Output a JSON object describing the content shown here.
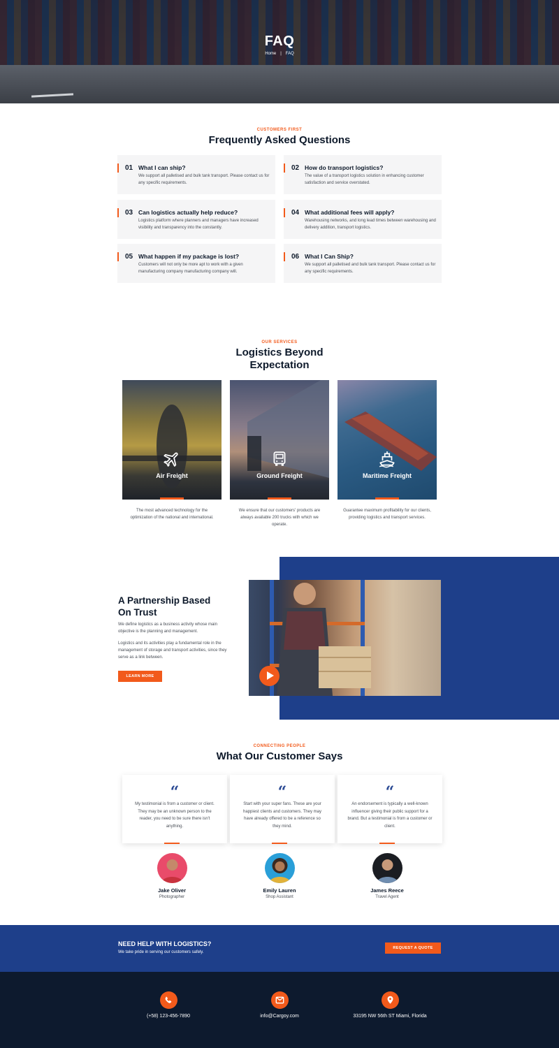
{
  "hero": {
    "title": "FAQ",
    "breadcrumb": {
      "home": "Home",
      "separator": "|",
      "current": "FAQ"
    }
  },
  "faq": {
    "eyebrow": "CUSTOMERS FIRST",
    "title": "Frequently Asked Questions",
    "items": [
      {
        "num": "01",
        "question": "What I can ship?",
        "answer": "We support all palletised and bulk tank transport. Please contact us for any specific requirements."
      },
      {
        "num": "02",
        "question": "How do transport logistics?",
        "answer": "The value of a transport logistics solution in enhancing customer satisfaction and service overstated."
      },
      {
        "num": "03",
        "question": "Can logistics actually help reduce?",
        "answer": "Logistics platform where planners and managers have increased visibility and transparency into the constantly."
      },
      {
        "num": "04",
        "question": "What additional fees will apply?",
        "answer": "Warehousing networks, and long lead times between warehousing and delivery addition, transport logistics."
      },
      {
        "num": "05",
        "question": "What happen if my package is lost?",
        "answer": "Customers will not only be more apt to work with a given manufacturing company manufacturing company will."
      },
      {
        "num": "06",
        "question": "What I Can Ship?",
        "answer": "We support all palletised and bulk tank transport. Please contact us for any specific requirements."
      }
    ]
  },
  "services": {
    "eyebrow": "OUR SERVICES",
    "title_line1": "Logistics Beyond",
    "title_line2": "Expectation",
    "items": [
      {
        "label": "Air Freight",
        "icon": "airplane-icon",
        "description": "The most advanced technology for the optimization of the national and international."
      },
      {
        "label": "Ground Freight",
        "icon": "truck-icon",
        "description": "We ensure that our customers' products are always available 200 trucks with which we operate."
      },
      {
        "label": "Maritime Freight",
        "icon": "ship-icon",
        "description": "Guarantee maximum profitability for our clients, providing logistics and transport services."
      }
    ]
  },
  "partnership": {
    "title_line1": "A Partnership Based",
    "title_line2": "On Trust",
    "paragraph1": "We define logistics as a business activity whose main objective is the planning and management.",
    "paragraph2": "Logistics and its activities play a fundamental role in the management of storage and transport activities, since they serve as a link between.",
    "button": "LEARN MORE"
  },
  "testimonials": {
    "eyebrow": "CONNECTING PEOPLE",
    "title": "What Our Customer Says",
    "items": [
      {
        "text": "My testimonial is from a customer or client. They may be an unknown person to the reader, you need to be sure there isn't anything.",
        "name": "Jake Oliver",
        "role": "Photographer"
      },
      {
        "text": "Start with your super fans. These are your happiest clients and customers. They may have already offered to be a reference so they mind.",
        "name": "Emily Lauren",
        "role": "Shop Assistant"
      },
      {
        "text": "An endorsement is typically a well-known influencer giving their public support for a brand. But a testimonial is from a customer or client.",
        "name": "James Reece",
        "role": "Travel Agent"
      }
    ]
  },
  "cta": {
    "title": "NEED HELP WITH LOGISTICS?",
    "subtitle": "We take pride in serving our customers safely.",
    "button": "REQUEST A QUOTE"
  },
  "footer": {
    "phone": "(+58) 123-456-7890",
    "email": "info@Cargoy.com",
    "address": "33195 NW 56th ST Miami, Florida"
  },
  "colors": {
    "accent": "#f25a1b",
    "navy": "#1e3f8a",
    "dark": "#0d1a2e"
  }
}
